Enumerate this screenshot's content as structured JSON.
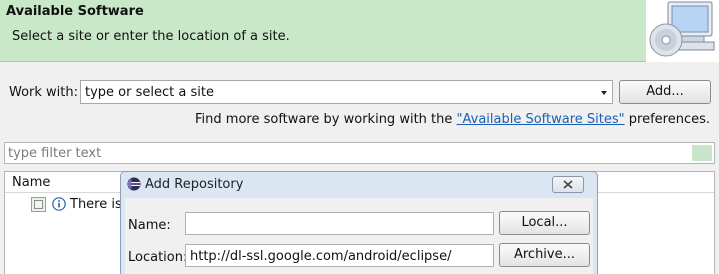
{
  "banner": {
    "title": "Available Software",
    "description": "Select a site or enter the location of a site."
  },
  "work_with": {
    "label": "Work with:",
    "value": "type or select a site",
    "add_button": "Add..."
  },
  "more_software": {
    "prefix": "Find more software by working with the ",
    "link": "\"Available Software Sites\"",
    "suffix": " preferences."
  },
  "filter": {
    "placeholder": "type filter text"
  },
  "table": {
    "columns": [
      "Name"
    ],
    "rows": [
      {
        "checked": false,
        "text": "There is"
      }
    ]
  },
  "dialog": {
    "title": "Add Repository",
    "name_label": "Name:",
    "name_value": "",
    "local_button": "Local...",
    "location_label": "Location:",
    "location_value": "http://dl-ssl.google.com/android/eclipse/",
    "archive_button": "Archive..."
  },
  "colors": {
    "banner_bg": "#c8e8c8",
    "dialog_frame": "#dbe6f3",
    "link": "#1a5fb4"
  },
  "icons": [
    "software-cd-icon",
    "dropdown-arrow-icon",
    "clear-filter-icon",
    "info-icon",
    "eclipse-icon",
    "close-icon"
  ]
}
